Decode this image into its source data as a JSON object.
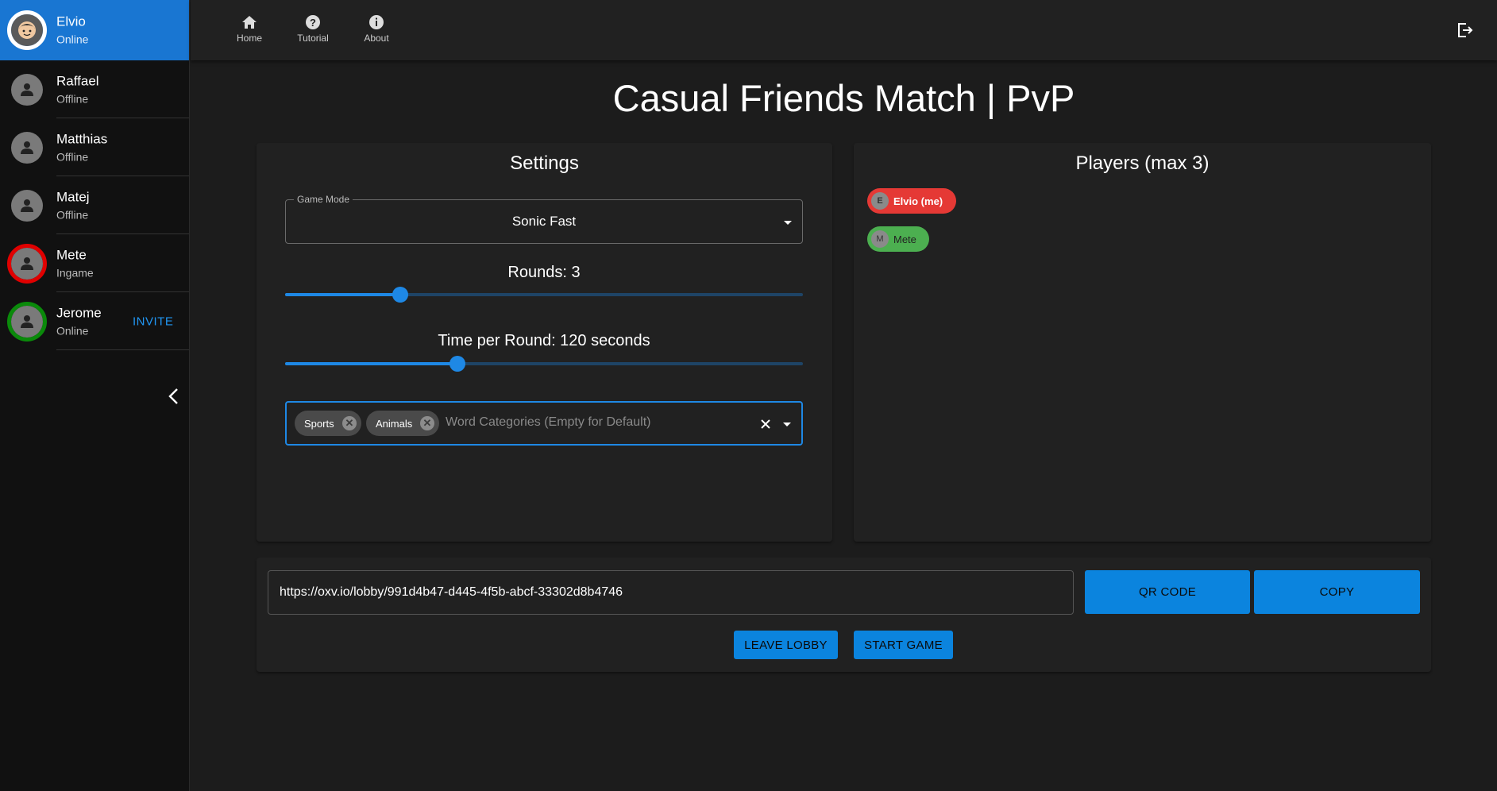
{
  "friends": [
    {
      "name": "Elvio",
      "status": "Online",
      "ring": "white",
      "active": true,
      "invite": ""
    },
    {
      "name": "Raffael",
      "status": "Offline",
      "ring": "none",
      "active": false,
      "invite": ""
    },
    {
      "name": "Matthias",
      "status": "Offline",
      "ring": "none",
      "active": false,
      "invite": ""
    },
    {
      "name": "Matej",
      "status": "Offline",
      "ring": "none",
      "active": false,
      "invite": ""
    },
    {
      "name": "Mete",
      "status": "Ingame",
      "ring": "red",
      "active": false,
      "invite": ""
    },
    {
      "name": "Jerome",
      "status": "Online",
      "ring": "green",
      "active": false,
      "invite": "INVITE"
    }
  ],
  "nav": {
    "home": "Home",
    "tutorial": "Tutorial",
    "about": "About"
  },
  "page_title": "Casual Friends Match | PvP",
  "settings": {
    "title": "Settings",
    "game_mode_label": "Game Mode",
    "game_mode_value": "Sonic Fast",
    "rounds_label": "Rounds: 3",
    "rounds_fraction": 0.222,
    "time_label": "Time per Round: 120 seconds",
    "time_fraction": 0.333,
    "categories": [
      "Sports",
      "Animals"
    ],
    "categories_placeholder": "Word Categories (Empty for Default)"
  },
  "players": {
    "title": "Players (max 3)",
    "list": [
      {
        "initial": "E",
        "name": "Elvio (me)",
        "color": "#e53935"
      },
      {
        "initial": "M",
        "name": "Mete",
        "color": "#4caf50"
      }
    ]
  },
  "lobby": {
    "url": "https://oxv.io/lobby/991d4b47-d445-4f5b-abcf-33302d8b4746",
    "qr_label": "QR CODE",
    "copy_label": "COPY",
    "leave_label": "LEAVE LOBBY",
    "start_label": "START GAME"
  },
  "colors": {
    "accent": "#1976d2",
    "button": "#0b84de",
    "background": "#1c1c1c"
  }
}
